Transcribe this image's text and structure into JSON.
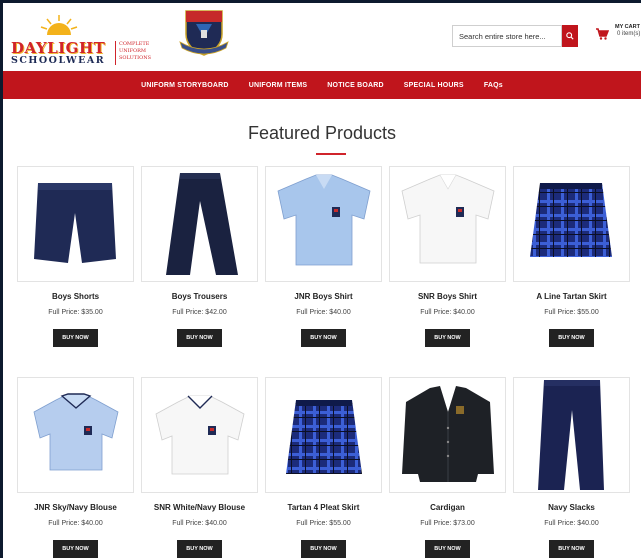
{
  "brand": {
    "name_line1": "DAYLIGHT",
    "name_line2": "SCHOOLWEAR",
    "tagline": "COMPLETE UNIFORM SOLUTIONS"
  },
  "search": {
    "placeholder": "Search entire store here..."
  },
  "cart": {
    "label": "MY CART",
    "count": "0 item(s)"
  },
  "nav": {
    "items": [
      {
        "label": "UNIFORM STORYBOARD"
      },
      {
        "label": "UNIFORM ITEMS"
      },
      {
        "label": "NOTICE BOARD"
      },
      {
        "label": "SPECIAL HOURS"
      },
      {
        "label": "FAQs"
      }
    ]
  },
  "section": {
    "title": "Featured Products"
  },
  "products": [
    {
      "name": "Boys Shorts",
      "price": "Full Price: $35.00",
      "buy_label": "BUY NOW"
    },
    {
      "name": "Boys Trousers",
      "price": "Full Price: $42.00",
      "buy_label": "BUY NOW"
    },
    {
      "name": "JNR Boys Shirt",
      "price": "Full Price: $40.00",
      "buy_label": "BUY NOW"
    },
    {
      "name": "SNR Boys Shirt",
      "price": "Full Price: $40.00",
      "buy_label": "BUY NOW"
    },
    {
      "name": "A Line Tartan Skirt",
      "price": "Full Price: $55.00",
      "buy_label": "BUY NOW"
    },
    {
      "name": "JNR Sky/Navy Blouse",
      "price": "Full Price: $40.00",
      "buy_label": "BUY NOW"
    },
    {
      "name": "SNR White/Navy Blouse",
      "price": "Full Price: $40.00",
      "buy_label": "BUY NOW"
    },
    {
      "name": "Tartan 4 Pleat Skirt",
      "price": "Full Price: $55.00",
      "buy_label": "BUY NOW"
    },
    {
      "name": "Cardigan",
      "price": "Full Price: $73.00",
      "buy_label": "BUY NOW"
    },
    {
      "name": "Navy Slacks",
      "price": "Full Price: $40.00",
      "buy_label": "BUY NOW"
    }
  ],
  "colors": {
    "accent": "#c0151c",
    "button": "#222222",
    "navy": "#1f2a55"
  }
}
